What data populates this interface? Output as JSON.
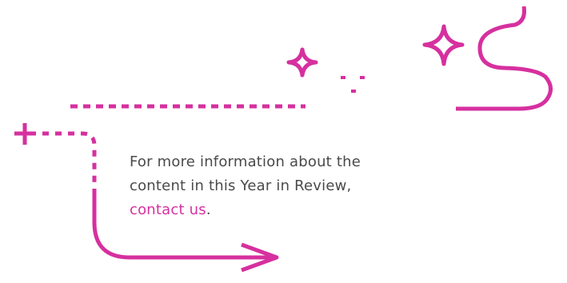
{
  "info": {
    "line1": "For more information about the",
    "line2": "content in this Year in Review,",
    "link_label": "contact us",
    "trailing": "."
  },
  "icons": [
    "sparkle-icon",
    "sparkle-icon",
    "plus-icon",
    "arrow-right-icon",
    "squiggle-line"
  ],
  "colors": {
    "accent": "#d6309f",
    "text": "#4a4a4a",
    "background": "#ffffff"
  }
}
